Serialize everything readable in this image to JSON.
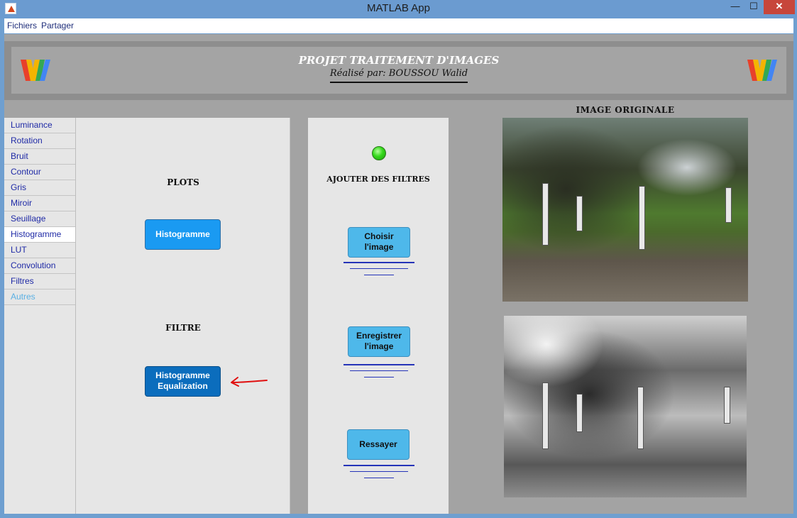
{
  "window": {
    "title": "MATLAB App",
    "minimize_glyph": "—",
    "maximize_glyph": "☐",
    "close_glyph": "✕"
  },
  "menu": {
    "items": [
      "Fichiers",
      "Partager"
    ]
  },
  "header": {
    "title": "PROJET TRAITEMENT D'IMAGES",
    "author": "Réalisé par: BOUSSOU Walid"
  },
  "tabs": {
    "items": [
      "Luminance",
      "Rotation",
      "Bruit",
      "Contour",
      "Gris",
      "Miroir",
      "Seuillage",
      "Histogramme",
      "LUT",
      "Convolution",
      "Filtres",
      "Autres"
    ],
    "selected": "Histogramme",
    "disabled": "Autres"
  },
  "plots_panel": {
    "plots_label": "PLOTS",
    "histogram_button": "Histogramme",
    "filter_label": "FILTRE",
    "equalization_button_line1": "Histogramme",
    "equalization_button_line2": "Equalization"
  },
  "actions_panel": {
    "status_light": "green",
    "add_filters_label": "AJOUTER DES FILTRES",
    "choose_button_line1": "Choisir",
    "choose_button_line2": "l'image",
    "save_button_line1": "Enregistrer",
    "save_button_line2": "l'image",
    "retry_button": "Ressayer"
  },
  "images": {
    "original_label": "IMAGE ORIGINALE"
  },
  "colors": {
    "window_chrome": "#6b9bd0",
    "client_bg": "#a3a3a3",
    "panel_bg": "#e6e6e6",
    "primary_button": "#1a9af2",
    "pressed_button": "#0b6dbd",
    "secondary_button": "#4eb8ea",
    "tab_text": "#1f2aa6",
    "annotation_arrow": "#e01010"
  },
  "icons": [
    "matlab-icon",
    "minimize-icon",
    "maximize-icon",
    "close-icon",
    "w-logo-icon",
    "status-led-icon",
    "red-arrow-annotation"
  ]
}
